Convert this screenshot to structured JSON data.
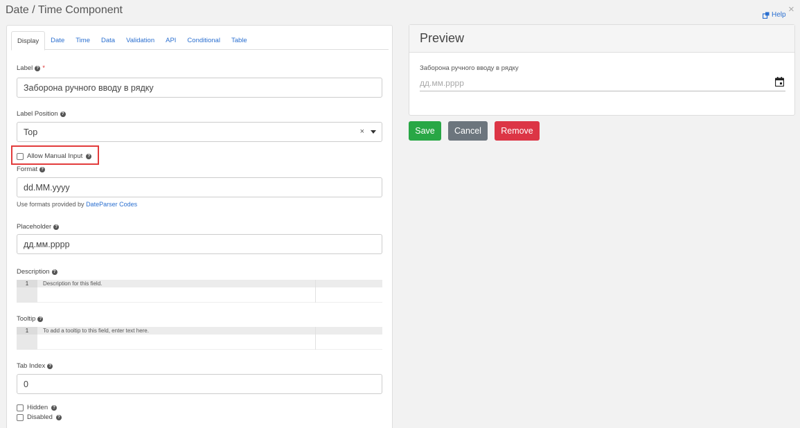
{
  "dialog": {
    "title": "Date / Time Component",
    "help_label": "Help",
    "close_glyph": "×"
  },
  "tabs": [
    {
      "label": "Display",
      "active": true
    },
    {
      "label": "Date"
    },
    {
      "label": "Time"
    },
    {
      "label": "Data"
    },
    {
      "label": "Validation"
    },
    {
      "label": "API"
    },
    {
      "label": "Conditional"
    },
    {
      "label": "Table"
    }
  ],
  "form": {
    "label": {
      "title": "Label",
      "required_mark": "*",
      "value": "Заборона ручного вводу в рядку"
    },
    "label_position": {
      "title": "Label Position",
      "value": "Top",
      "clear_glyph": "×"
    },
    "allow_manual_input": {
      "title": "Allow Manual Input",
      "checked": false
    },
    "format": {
      "title": "Format",
      "value": "dd.MM.yyyy",
      "hint_prefix": "Use formats provided by",
      "hint_link": "DateParser Codes"
    },
    "placeholder": {
      "title": "Placeholder",
      "value": "дд.мм.рррр"
    },
    "description": {
      "title": "Description",
      "line_number": "1",
      "editor_placeholder": "Description for this field."
    },
    "tooltip": {
      "title": "Tooltip",
      "line_number": "1",
      "editor_placeholder": "To add a tooltip to this field, enter text here."
    },
    "tab_index": {
      "title": "Tab Index",
      "value": "0"
    },
    "hidden": {
      "title": "Hidden",
      "checked": false
    },
    "disabled": {
      "title": "Disabled",
      "checked": false
    }
  },
  "preview": {
    "heading": "Preview",
    "field_label": "Заборона ручного вводу в рядку",
    "field_placeholder": "дд.мм.рррр"
  },
  "actions": {
    "save": "Save",
    "cancel": "Cancel",
    "remove": "Remove"
  },
  "colors": {
    "link": "#2a6fd0",
    "save": "#28a745",
    "cancel": "#6c757d",
    "remove": "#dc3545",
    "highlight": "#e23b3b"
  }
}
